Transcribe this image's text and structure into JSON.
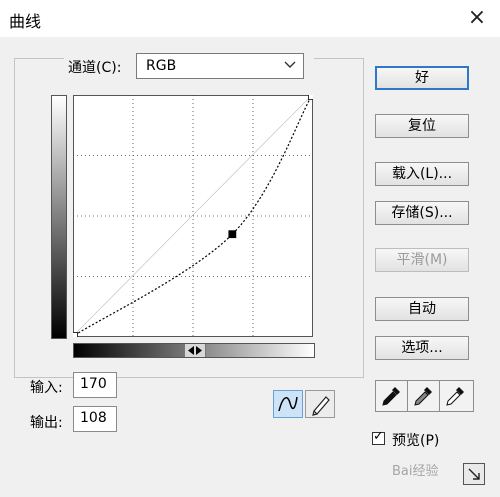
{
  "window": {
    "title": "曲线",
    "close_glyph": "×"
  },
  "channel": {
    "label": "通道(C):",
    "value": "RGB"
  },
  "curve": {
    "grid_divisions": 4,
    "points": [
      {
        "input": 0,
        "output": 0
      },
      {
        "input": 170,
        "output": 108
      },
      {
        "input": 255,
        "output": 255
      }
    ],
    "selected_point_index": 1
  },
  "input": {
    "label": "输入:",
    "value": "170"
  },
  "output": {
    "label": "输出:",
    "value": "108"
  },
  "buttons": {
    "ok": "好",
    "reset": "复位",
    "load": "载入(L)...",
    "save": "存储(S)...",
    "smooth": "平滑(M)",
    "auto": "自动",
    "options": "选项..."
  },
  "tools": {
    "curve_icon": "curve-icon",
    "pencil_icon": "pencil-icon"
  },
  "eyedroppers": [
    "black-point-eyedropper-icon",
    "gray-point-eyedropper-icon",
    "white-point-eyedropper-icon"
  ],
  "preview": {
    "label": "预览(P)",
    "checked": true,
    "check_glyph": "✓"
  },
  "watermark": {
    "text": "Bai经验"
  }
}
